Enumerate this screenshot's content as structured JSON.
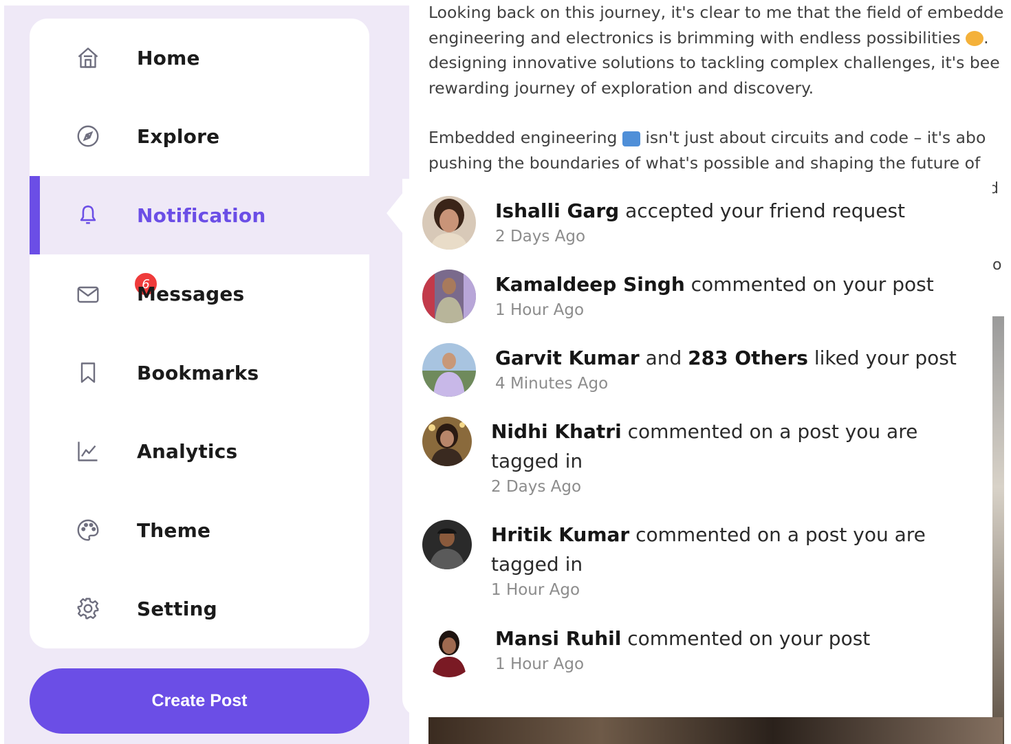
{
  "nav": {
    "items": [
      {
        "label": "Home",
        "icon": "home-icon"
      },
      {
        "label": "Explore",
        "icon": "compass-icon"
      },
      {
        "label": "Notification",
        "icon": "bell-icon",
        "active": true
      },
      {
        "label": "Messages",
        "icon": "mail-icon",
        "badge": "6"
      },
      {
        "label": "Bookmarks",
        "icon": "bookmark-icon"
      },
      {
        "label": "Analytics",
        "icon": "chart-icon"
      },
      {
        "label": "Theme",
        "icon": "palette-icon"
      },
      {
        "label": "Setting",
        "icon": "gear-icon"
      }
    ],
    "create_post_label": "Create Post"
  },
  "feed": {
    "line1": "Looking back on this journey, it's clear to me that the field of embedde",
    "line2": "engineering and electronics is brimming with endless possibilities",
    "line2_end": ".",
    "line3": "designing innovative solutions to tackling complex challenges, it's bee",
    "line4": "rewarding journey of exploration and discovery.",
    "line5a": "Embedded engineering",
    "line5b": " isn't just about circuits and code – it's abo",
    "line6": "pushing the boundaries of what's possible and shaping the future of",
    "frag1": "d",
    "frag2": "o"
  },
  "notifications": [
    {
      "name": "Ishalli Garg",
      "action": " accepted your friend request",
      "time": "2 Days Ago"
    },
    {
      "name": "Kamaldeep Singh",
      "action": " commented on your post",
      "time": "1 Hour Ago"
    },
    {
      "name": "Garvit Kumar",
      "connector": " and ",
      "others": "283 Others",
      "action": " liked your post",
      "time": "4 Minutes Ago"
    },
    {
      "name": "Nidhi Khatri",
      "action": " commented on a post you are",
      "action2": "tagged in",
      "time": "2 Days Ago"
    },
    {
      "name": "Hritik Kumar",
      "action": " commented on a post you are",
      "action2": "tagged in",
      "time": "1 Hour Ago"
    },
    {
      "name": "Mansi Ruhil",
      "action": " commented on your post",
      "time": "1 Hour Ago"
    }
  ],
  "colors": {
    "accent": "#6b4ee6",
    "panel_bg": "#efe9f7",
    "badge": "#ef3b3b"
  }
}
